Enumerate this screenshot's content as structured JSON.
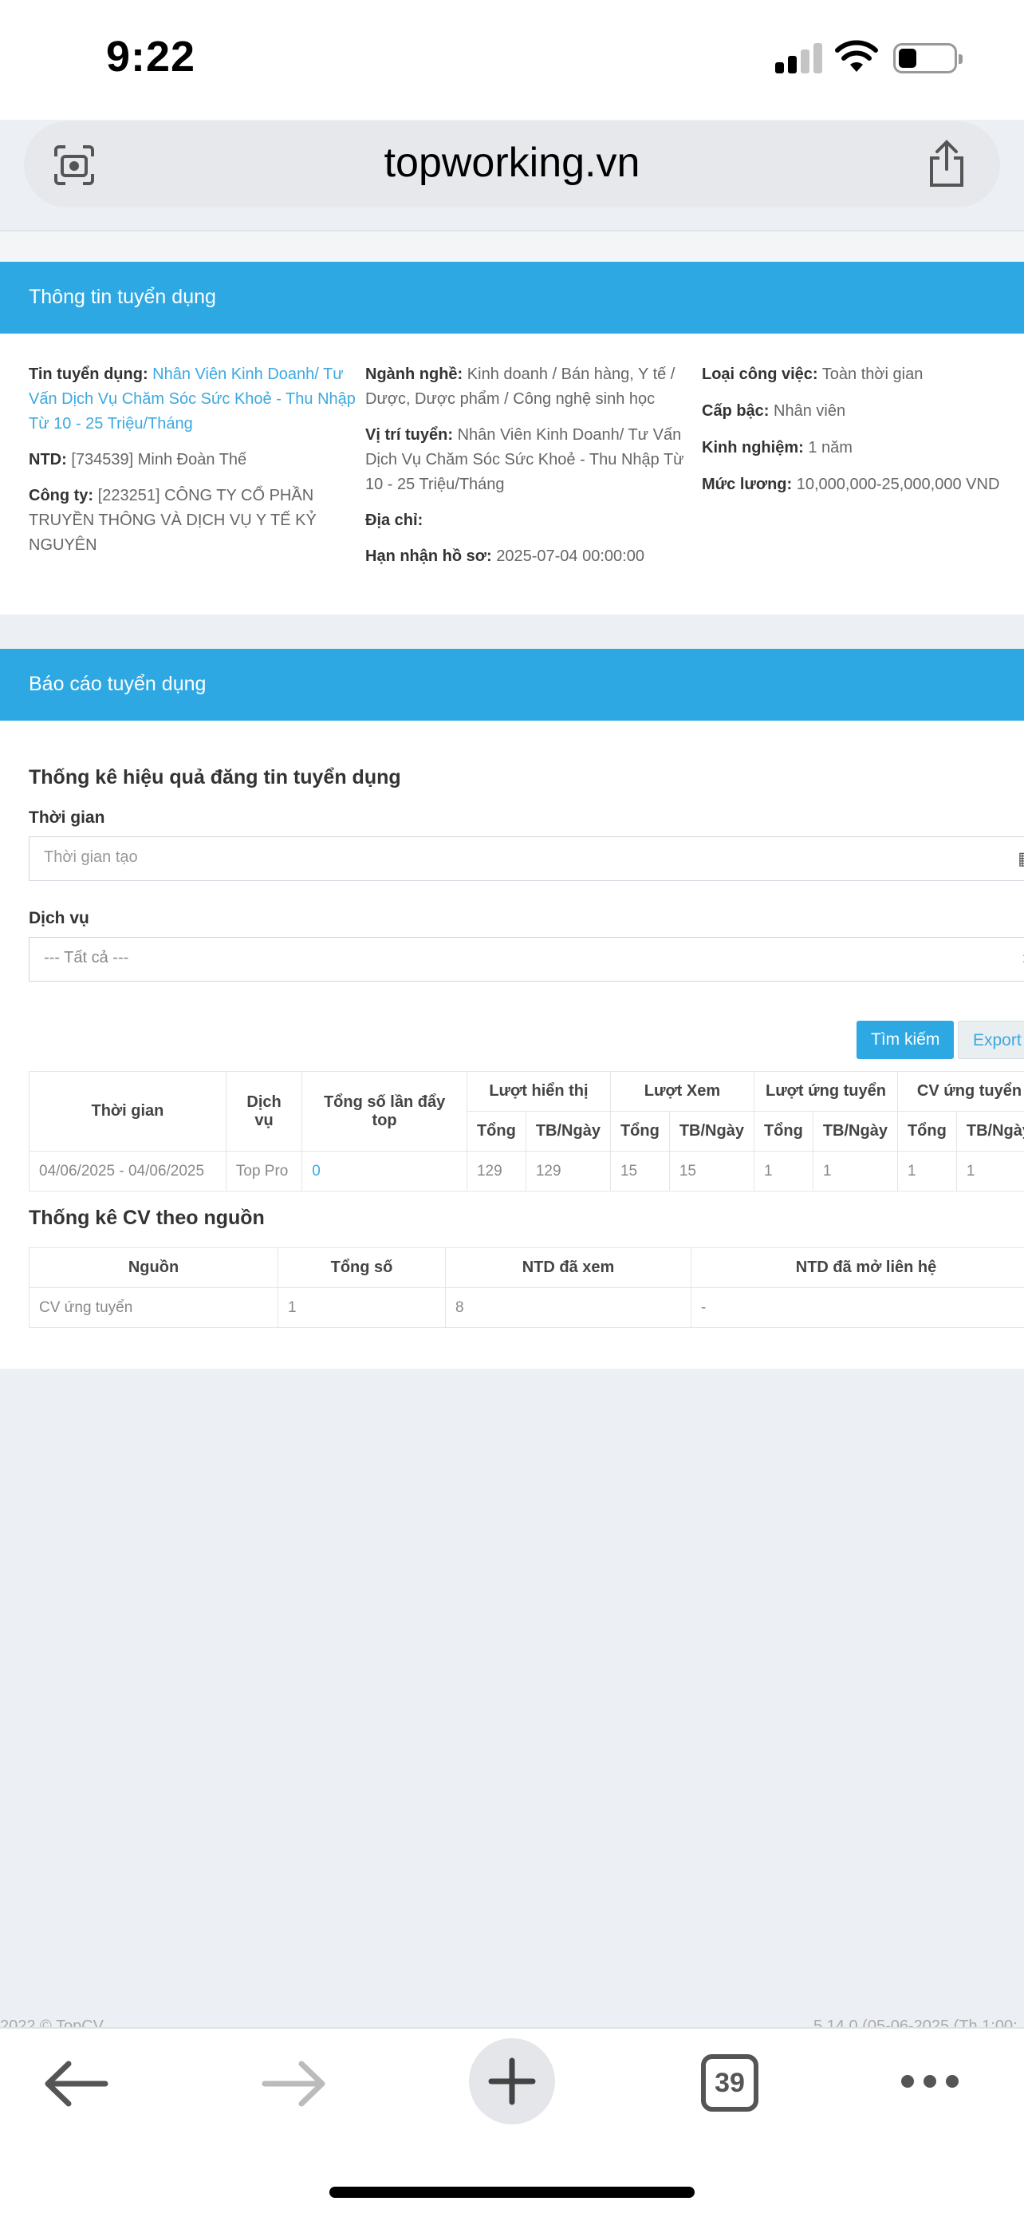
{
  "status": {
    "time": "9:22"
  },
  "browser": {
    "url": "topworking.vn",
    "tab_count": "39"
  },
  "info_panel": {
    "title": "Thông tin tuyển dụng",
    "col1": {
      "job_label": "Tin tuyển dụng:",
      "job_value": "Nhân Viên Kinh Doanh/ Tư Vấn Dịch Vụ Chăm Sóc Sức Khoẻ - Thu Nhập Từ 10 - 25 Triệu/Tháng",
      "ntd_label": "NTD:",
      "ntd_value": "[734539] Minh Đoàn Thế",
      "company_label": "Công ty:",
      "company_value": "[223251] CÔNG TY CỔ PHẦN TRUYỀN THÔNG VÀ DỊCH VỤ Y TẾ KỶ NGUYÊN"
    },
    "col2": {
      "industry_label": "Ngành nghề:",
      "industry_value": "Kinh doanh / Bán hàng, Y tế / Dược, Dược phẩm / Công nghệ sinh học",
      "position_label": "Vị trí tuyển:",
      "position_value": "Nhân Viên Kinh Doanh/ Tư Vấn Dịch Vụ Chăm Sóc Sức Khoẻ - Thu Nhập Từ 10 - 25 Triệu/Tháng",
      "address_label": "Địa chỉ:",
      "deadline_label": "Hạn nhận hồ sơ:",
      "deadline_value": "2025-07-04 00:00:00"
    },
    "col3": {
      "type_label": "Loại công việc:",
      "type_value": "Toàn thời gian",
      "level_label": "Cấp bậc:",
      "level_value": "Nhân viên",
      "exp_label": "Kinh nghiệm:",
      "exp_value": "1 năm",
      "salary_label": "Mức lương:",
      "salary_value": "10,000,000-25,000,000 VND"
    }
  },
  "report_panel": {
    "title": "Báo cáo tuyển dụng",
    "stats_title": "Thống kê hiệu quả đăng tin tuyển dụng",
    "time_label": "Thời gian",
    "time_placeholder": "Thời gian tạo",
    "service_label": "Dịch vụ",
    "service_selected": "--- Tất cả ---",
    "search_button": "Tìm kiếm",
    "export_button": "Export",
    "stats_table": {
      "headers": {
        "time": "Thời gian",
        "service": "Dịch vụ",
        "push_top": "Tổng số lần đẩy top",
        "impressions": "Lượt hiển thị",
        "views": "Lượt Xem",
        "applies": "Lượt ứng tuyển",
        "cv_applies": "CV ứng tuyển",
        "total": "Tổng",
        "per_day": "TB/Ngày"
      },
      "row": {
        "time": "04/06/2025 - 04/06/2025",
        "service": "Top Pro",
        "push_top": "0",
        "imp_total": "129",
        "imp_day": "129",
        "view_total": "15",
        "view_day": "15",
        "apply_total": "1",
        "apply_day": "1",
        "cv_total": "1",
        "cv_day": "1"
      }
    },
    "cv_title": "Thống kê CV theo nguồn",
    "cv_table": {
      "headers": {
        "source": "Nguồn",
        "total": "Tổng số",
        "viewed": "NTD đã xem",
        "contacted": "NTD đã mở liên hệ"
      },
      "row": {
        "source": "CV ứng tuyển",
        "total": "1",
        "viewed": "8",
        "contacted": "-"
      }
    }
  },
  "footer": {
    "left": "2022 © TopCV.",
    "right": "5.14.0 (05-06-2025 (Th 1:00:..."
  }
}
